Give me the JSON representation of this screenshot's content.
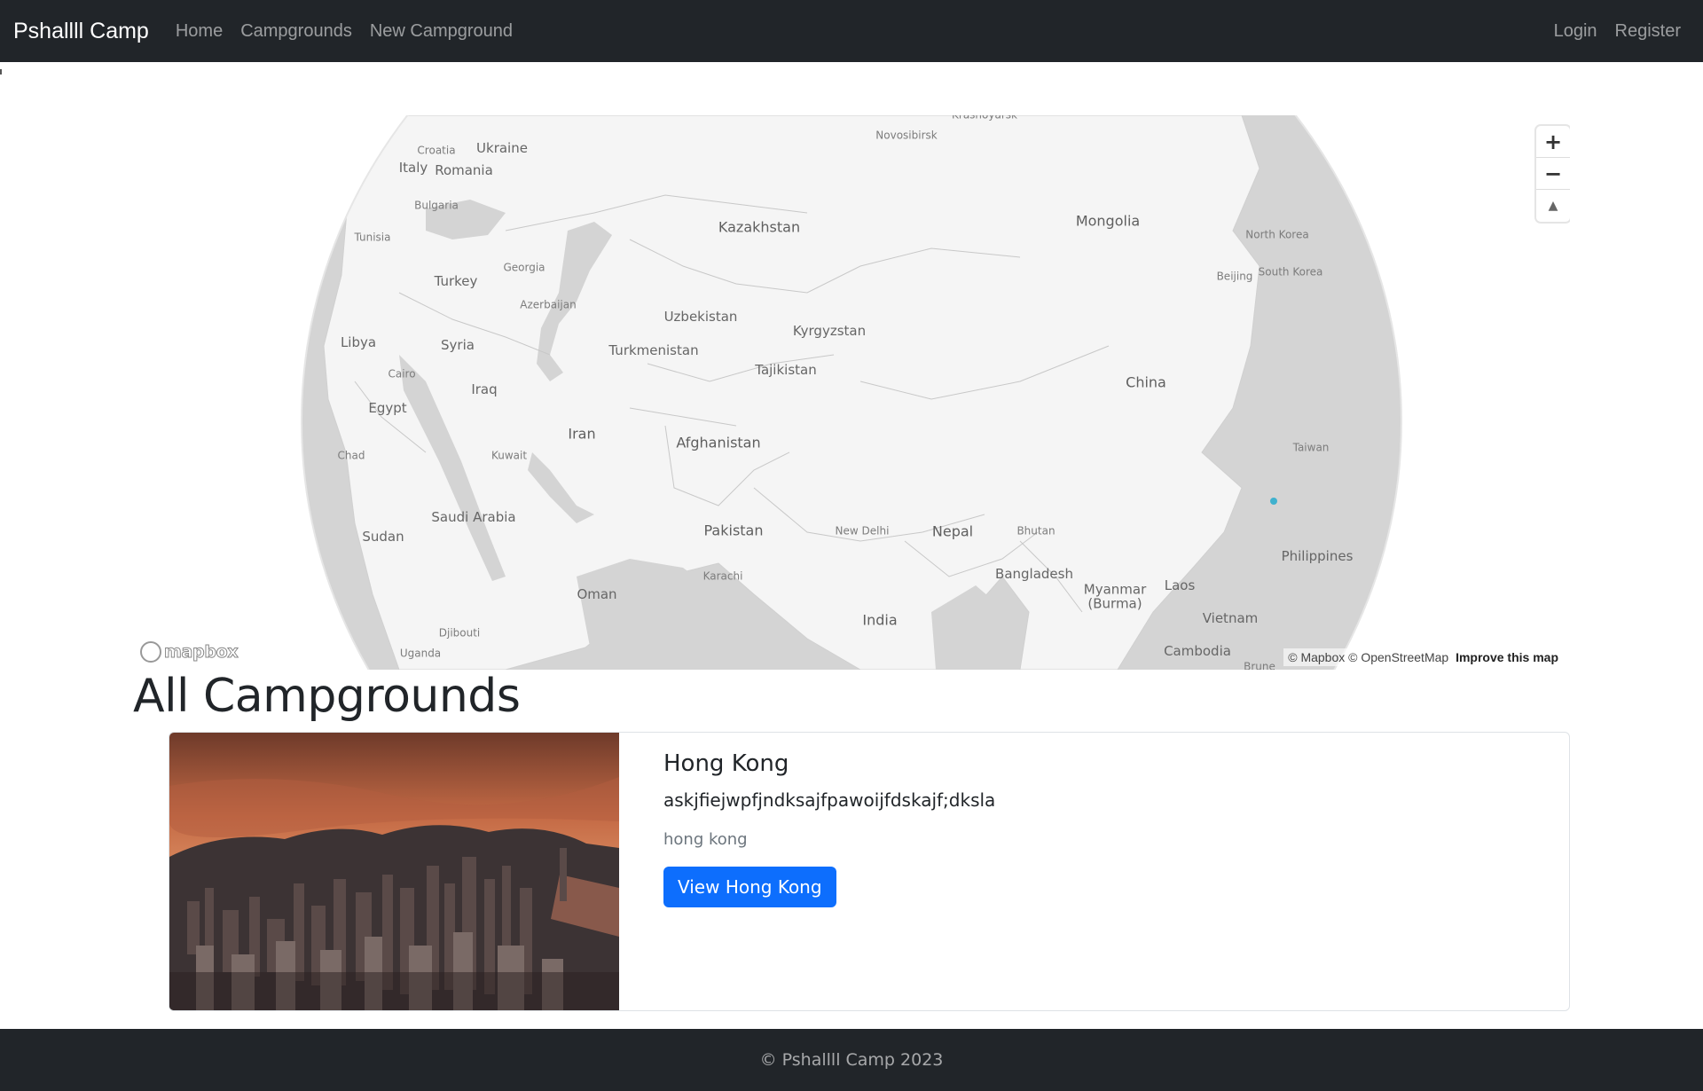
{
  "navbar": {
    "brand": "Pshallll Camp",
    "links": [
      "Home",
      "Campgrounds",
      "New Campground"
    ],
    "right_links": [
      "Login",
      "Register"
    ]
  },
  "map": {
    "labels": [
      {
        "text": "Krasnoyarsk",
        "cls": "small"
      },
      {
        "text": "Novosibirsk",
        "cls": "small"
      },
      {
        "text": "Croatia",
        "cls": "small"
      },
      {
        "text": "Ukraine",
        "cls": "mid"
      },
      {
        "text": "Italy",
        "cls": "mid"
      },
      {
        "text": "Romania",
        "cls": "mid"
      },
      {
        "text": "Bulgaria",
        "cls": "small"
      },
      {
        "text": "Kazakhstan",
        "cls": "big"
      },
      {
        "text": "Mongolia",
        "cls": "big"
      },
      {
        "text": "Tunisia",
        "cls": "small"
      },
      {
        "text": "Georgia",
        "cls": "small"
      },
      {
        "text": "North Korea",
        "cls": "small"
      },
      {
        "text": "Turkey",
        "cls": "mid"
      },
      {
        "text": "Beijing",
        "cls": "small"
      },
      {
        "text": "South Korea",
        "cls": "small"
      },
      {
        "text": "Azerbaijan",
        "cls": "small"
      },
      {
        "text": "Uzbekistan",
        "cls": "mid"
      },
      {
        "text": "Kyrgyzstan",
        "cls": "mid"
      },
      {
        "text": "Libya",
        "cls": "mid"
      },
      {
        "text": "Syria",
        "cls": "mid"
      },
      {
        "text": "Turkmenistan",
        "cls": "mid"
      },
      {
        "text": "Tajikistan",
        "cls": "mid"
      },
      {
        "text": "Cairo",
        "cls": "small"
      },
      {
        "text": "China",
        "cls": "big"
      },
      {
        "text": "Iraq",
        "cls": "mid"
      },
      {
        "text": "Egypt",
        "cls": "mid"
      },
      {
        "text": "Iran",
        "cls": "big"
      },
      {
        "text": "Afghanistan",
        "cls": "big"
      },
      {
        "text": "Taiwan",
        "cls": "small"
      },
      {
        "text": "Chad",
        "cls": "small"
      },
      {
        "text": "Kuwait",
        "cls": "small"
      },
      {
        "text": "Saudi Arabia",
        "cls": "mid"
      },
      {
        "text": "Pakistan",
        "cls": "big"
      },
      {
        "text": "New Delhi",
        "cls": "small"
      },
      {
        "text": "Nepal",
        "cls": "big"
      },
      {
        "text": "Bhutan",
        "cls": "small"
      },
      {
        "text": "Sudan",
        "cls": "mid"
      },
      {
        "text": "Philippines",
        "cls": "mid"
      },
      {
        "text": "Karachi",
        "cls": "small"
      },
      {
        "text": "Bangladesh",
        "cls": "mid"
      },
      {
        "text": "Myanmar\n(Burma)",
        "cls": "mid"
      },
      {
        "text": "Laos",
        "cls": "mid"
      },
      {
        "text": "Oman",
        "cls": "mid"
      },
      {
        "text": "India",
        "cls": "big"
      },
      {
        "text": "Vietnam",
        "cls": "mid"
      },
      {
        "text": "Djibouti",
        "cls": "small"
      },
      {
        "text": "Uganda",
        "cls": "small"
      },
      {
        "text": "Cambodia",
        "cls": "mid"
      },
      {
        "text": "Brune",
        "cls": "small"
      }
    ],
    "zoom_in": "+",
    "zoom_out": "−",
    "compass": "▲",
    "logo_text": "mapbox",
    "attribution": "© Mapbox © OpenStreetMap",
    "improve": "Improve this map",
    "marker_color": "#3fb1ce"
  },
  "heading": "All Campgrounds",
  "campgrounds": [
    {
      "title": "Hong Kong",
      "description": "askjfiejwpfjndksajfpawoijfdskajf;dksla",
      "location": "hong kong",
      "button": "View Hong Kong"
    }
  ],
  "footer": "© Pshallll Camp 2023",
  "colors": {
    "navbar": "#212529",
    "primary": "#0d6efd",
    "muted": "#6c757d"
  }
}
